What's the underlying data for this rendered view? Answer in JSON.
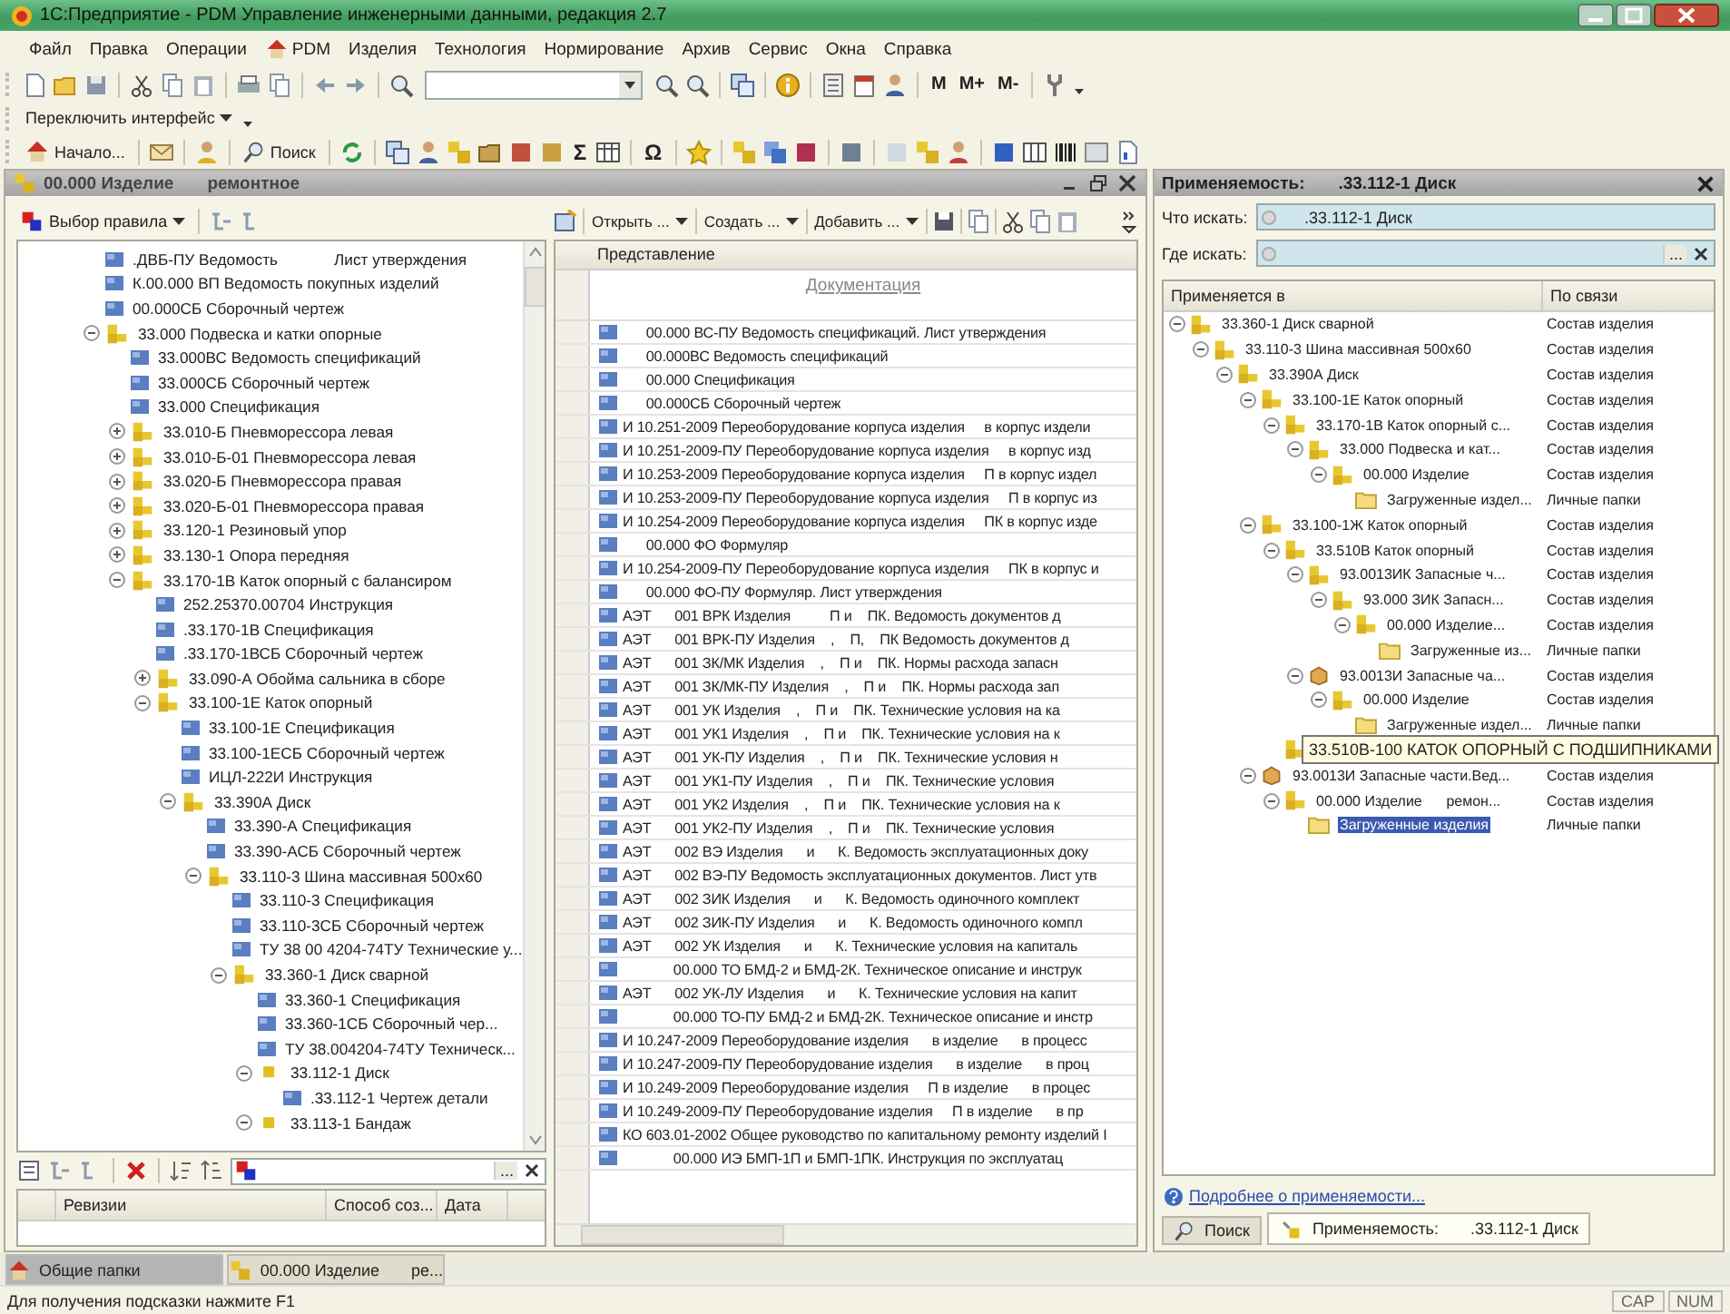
{
  "window": {
    "title": "1С:Предприятие - PDM Управление инженерными данными, редакция 2.7"
  },
  "menu": [
    {
      "label": "Файл",
      "kind": "plain"
    },
    {
      "label": "Правка",
      "kind": "plain"
    },
    {
      "label": "Операции",
      "kind": "plain"
    },
    {
      "label": "PDM",
      "kind": "with_icon"
    },
    {
      "label": "Изделия",
      "kind": "plain"
    },
    {
      "label": "Технология",
      "kind": "plain"
    },
    {
      "label": "Нормирование",
      "kind": "plain"
    },
    {
      "label": "Архив",
      "kind": "plain"
    },
    {
      "label": "Сервис",
      "kind": "plain"
    },
    {
      "label": "Окна",
      "kind": "plain"
    },
    {
      "label": "Справка",
      "kind": "plain"
    }
  ],
  "memory_buttons": [
    "M",
    "M+",
    "M-"
  ],
  "interface_switch": {
    "label": "Переключить интерфейс"
  },
  "quick_toolbar": {
    "buttons": [
      {
        "label": "Начало...",
        "kind": "home"
      },
      {
        "label": "Поиск",
        "kind": "search"
      }
    ],
    "glyphs": [
      "Σ",
      "Ω"
    ]
  },
  "product_window": {
    "title": "00.000 Изделие       ремонтное",
    "rule_button": "Выбор правила",
    "tree": [
      {
        "label": ".ДВБ-ПУ Ведомость             Лист утверждения",
        "kind": "doc"
      },
      {
        "label": "К.00.000 ВП Ведомость покупных изделий",
        "kind": "doc"
      },
      {
        "label": "00.000СБ Сборочный чертеж",
        "kind": "doc"
      },
      {
        "label": "33.000 Подвеска и катки опорные",
        "kind": "assembly",
        "expanded": true,
        "children": [
          {
            "label": "33.000ВС Ведомость спецификаций",
            "kind": "doc"
          },
          {
            "label": "33.000СБ Сборочный чертеж",
            "kind": "doc"
          },
          {
            "label": "33.000 Спецификация",
            "kind": "doc"
          },
          {
            "label": "33.010-Б Пневморессора левая",
            "kind": "assembly",
            "expanded": false
          },
          {
            "label": "33.010-Б-01 Пневморессора левая",
            "kind": "assembly",
            "expanded": false
          },
          {
            "label": "33.020-Б Пневморессора правая",
            "kind": "assembly",
            "expanded": false
          },
          {
            "label": "33.020-Б-01 Пневморессора правая",
            "kind": "assembly",
            "expanded": false
          },
          {
            "label": "33.120-1 Резиновый упор",
            "kind": "assembly",
            "expanded": false
          },
          {
            "label": "33.130-1 Опора передняя",
            "kind": "assembly",
            "expanded": false
          },
          {
            "label": "33.170-1В Каток опорный с балансиром",
            "kind": "assembly",
            "expanded": true,
            "children": [
              {
                "label": "252.25370.00704 Инструкция",
                "kind": "doc"
              },
              {
                "label": ".33.170-1В Спецификация",
                "kind": "doc"
              },
              {
                "label": ".33.170-1ВСБ Сборочный чертеж",
                "kind": "doc"
              },
              {
                "label": "33.090-А Обойма сальника в сборе",
                "kind": "assembly",
                "expanded": false
              },
              {
                "label": "33.100-1Е Каток опорный",
                "kind": "assembly",
                "expanded": true,
                "children": [
                  {
                    "label": "33.100-1Е Спецификация",
                    "kind": "doc"
                  },
                  {
                    "label": "33.100-1ЕСБ Сборочный чертеж",
                    "kind": "doc"
                  },
                  {
                    "label": "ИЦЛ-222И Инструкция",
                    "kind": "doc"
                  },
                  {
                    "label": "33.390А Диск",
                    "kind": "assembly",
                    "expanded": true,
                    "children": [
                      {
                        "label": "33.390-А Спецификация",
                        "kind": "doc"
                      },
                      {
                        "label": "33.390-АСБ Сборочный чертеж",
                        "kind": "doc"
                      },
                      {
                        "label": "33.110-3 Шина массивная 500х60",
                        "kind": "assembly",
                        "expanded": true,
                        "children": [
                          {
                            "label": "33.110-3 Спецификация",
                            "kind": "doc"
                          },
                          {
                            "label": "33.110-3СБ Сборочный чертеж",
                            "kind": "doc"
                          },
                          {
                            "label": "ТУ 38 00 4204-74ТУ Технические у...",
                            "kind": "doc"
                          },
                          {
                            "label": "33.360-1 Диск сварной",
                            "kind": "assembly",
                            "expanded": true,
                            "children": [
                              {
                                "label": "33.360-1 Спецификация",
                                "kind": "doc"
                              },
                              {
                                "label": "33.360-1СБ Сборочный чер...",
                                "kind": "doc"
                              },
                              {
                                "label": "ТУ 38.004204-74ТУ Техническ...",
                                "kind": "doc"
                              },
                              {
                                "label": "33.112-1 Диск",
                                "kind": "part",
                                "expanded": true,
                                "children": [
                                  {
                                    "label": ".33.112-1 Чертеж детали",
                                    "kind": "doc"
                                  }
                                ]
                              },
                              {
                                "label": "33.113-1 Бандаж",
                                "kind": "part",
                                "expanded": true
                              }
                            ]
                          }
                        ]
                      }
                    ]
                  }
                ]
              }
            ]
          }
        ]
      }
    ],
    "filter_field": {
      "select_button": "..."
    },
    "revisions_columns": [
      "Ревизии",
      "Способ соз...",
      "Дата"
    ]
  },
  "documents": {
    "toolbar": [
      "Открыть ...",
      "Создать ...",
      "Добавить ..."
    ],
    "column": "Представление",
    "group": "Документация",
    "rows": [
      {
        "text": "      00.000 ВС-ПУ Ведомость спецификаций. Лист утверждения"
      },
      {
        "text": "      00.000ВС Ведомость спецификаций"
      },
      {
        "text": "      00.000 Спецификация"
      },
      {
        "text": "      00.000СБ Сборочный чертеж"
      },
      {
        "text": "И 10.251-2009 Переоборудование корпуса изделия     в корпус издели"
      },
      {
        "text": "И 10.251-2009-ПУ Переоборудование корпуса изделия     в корпус изд"
      },
      {
        "text": "И 10.253-2009 Переоборудование корпуса изделия     П в корпус издел"
      },
      {
        "text": "И 10.253-2009-ПУ Переоборудование корпуса изделия     П в корпус из"
      },
      {
        "text": "И 10.254-2009 Переоборудование корпуса изделия     ПК в корпус изде"
      },
      {
        "text": "      00.000 ФО Формуляр"
      },
      {
        "text": "И 10.254-2009-ПУ Переоборудование корпуса изделия     ПК в корпус и"
      },
      {
        "text": "      00.000 ФО-ПУ Формуляр. Лист утверждения"
      },
      {
        "text": "АЭТ      001 ВРК Изделия          П и    ПК. Ведомость документов д"
      },
      {
        "text": "АЭТ      001 ВРК-ПУ Изделия    ,    П,    ПК Ведомость документов д"
      },
      {
        "text": "АЭТ      001 ЗК/МК Изделия    ,    П и    ПК. Нормы расхода запасн"
      },
      {
        "text": "АЭТ      001 ЗК/МК-ПУ Изделия    ,    П и    ПК. Нормы расхода зап"
      },
      {
        "text": "АЭТ      001 УК Изделия    ,    П и    ПК. Технические условия на ка"
      },
      {
        "text": "АЭТ      001 УК1 Изделия    ,    П и    ПК. Технические условия на к"
      },
      {
        "text": "АЭТ      001 УК-ПУ Изделия    ,    П и    ПК. Технические условия н"
      },
      {
        "text": "АЭТ      001 УК1-ПУ Изделия    ,    П и    ПК. Технические условия"
      },
      {
        "text": "АЭТ      001 УК2 Изделия    ,    П и    ПК. Технические условия на к"
      },
      {
        "text": "АЭТ      001 УК2-ПУ Изделия    ,    П и    ПК. Технические условия"
      },
      {
        "text": "АЭТ      002 ВЭ Изделия      и      К. Ведомость эксплуатационных доку"
      },
      {
        "text": "АЭТ      002 ВЭ-ПУ Ведомость эксплуатационных документов. Лист утв"
      },
      {
        "text": "АЭТ      002 ЗИК Изделия      и      К. Ведомость одиночного комплект"
      },
      {
        "text": "АЭТ      002 ЗИК-ПУ Изделия      и      К. Ведомость одиночного компл"
      },
      {
        "text": "АЭТ      002 УК Изделия      и      К. Технические условия на капиталь"
      },
      {
        "text": "             00.000 ТО БМД-2 и БМД-2К. Техническое описание и инструк"
      },
      {
        "text": "АЭТ      002 УК-ЛУ Изделия      и      К. Технические условия на капит"
      },
      {
        "text": "             00.000 ТО-ПУ БМД-2 и БМД-2К. Техническое описание и инстр"
      },
      {
        "text": "И 10.247-2009 Переоборудование изделия      в изделие      в процесс"
      },
      {
        "text": "И 10.247-2009-ПУ Переоборудование изделия      в изделие      в проц"
      },
      {
        "text": "И 10.249-2009 Переоборудование изделия     П в изделие      в процес"
      },
      {
        "text": "И 10.249-2009-ПУ Переоборудование изделия     П в изделие      в пр"
      },
      {
        "text": "КО 603.01-2002 Общее руководство по капитальному ремонту изделий I"
      },
      {
        "text": "             00.000 ИЭ БМП-1П и БМП-1ПК. Инструкция по эксплуатац"
      }
    ]
  },
  "usage_panel": {
    "title": "Применяемость:       .33.112-1 Диск",
    "what_label": "Что искать:",
    "what_value": "     .33.112-1 Диск",
    "where_label": "Где искать:",
    "where_select_button": "...",
    "columns": [
      "Применяется в",
      "По связи"
    ],
    "tree": [
      {
        "label": "33.360-1 Диск сварной",
        "relation": "Состав изделия",
        "kind": "assembly",
        "expanded": true,
        "selected": false,
        "children": [
          {
            "label": "33.110-3 Шина массивная 500х60",
            "relation": "Состав изделия",
            "kind": "assembly",
            "expanded": true,
            "selected": false,
            "children": [
              {
                "label": "33.390А Диск",
                "relation": "Состав изделия",
                "kind": "assembly",
                "expanded": true,
                "selected": false,
                "children": [
                  {
                    "label": "33.100-1Е Каток опорный",
                    "relation": "Состав изделия",
                    "kind": "assembly",
                    "expanded": true,
                    "selected": false,
                    "children": [
                      {
                        "label": "33.170-1В Каток опорный с...",
                        "relation": "Состав изделия",
                        "kind": "assembly",
                        "expanded": true,
                        "selected": false,
                        "children": [
                          {
                            "label": "33.000 Подвеска и кат...",
                            "relation": "Состав изделия",
                            "kind": "assembly",
                            "expanded": true,
                            "selected": false,
                            "children": [
                              {
                                "label": "00.000 Изделие",
                                "relation": "Состав изделия",
                                "kind": "assembly",
                                "expanded": true,
                                "selected": false,
                                "children": [
                                  {
                                    "label": "Загруженные издел...",
                                    "relation": "Личные папки",
                                    "kind": "folder",
                                    "selected": false
                                  }
                                ]
                              }
                            ]
                          }
                        ]
                      }
                    ]
                  },
                  {
                    "label": "33.100-1Ж Каток опорный",
                    "relation": "Состав изделия",
                    "kind": "assembly",
                    "expanded": true,
                    "selected": false,
                    "children": [
                      {
                        "label": "33.510В Каток опорный",
                        "relation": "Состав изделия",
                        "kind": "assembly",
                        "expanded": true,
                        "selected": false,
                        "children": [
                          {
                            "label": "93.0013ИК Запасные ч...",
                            "relation": "Состав изделия",
                            "kind": "assembly",
                            "expanded": true,
                            "selected": false,
                            "children": [
                              {
                                "label": "93.000 ЗИК Запасн...",
                                "relation": "Состав изделия",
                                "kind": "assembly",
                                "expanded": true,
                                "selected": false,
                                "children": [
                                  {
                                    "label": "00.000 Изделие...",
                                    "relation": "Состав изделия",
                                    "kind": "assembly",
                                    "expanded": true,
                                    "selected": false,
                                    "children": [
                                      {
                                        "label": "Загруженные из...",
                                        "relation": "Личные папки",
                                        "kind": "folder",
                                        "selected": false
                                      }
                                    ]
                                  }
                                ]
                              }
                            ]
                          },
                          {
                            "label": "93.0013И Запасные ча...",
                            "relation": "Состав изделия",
                            "kind": "kit",
                            "expanded": true,
                            "selected": false,
                            "children": [
                              {
                                "label": "00.000 Изделие",
                                "relation": "Состав изделия",
                                "kind": "assembly",
                                "expanded": true,
                                "selected": false,
                                "children": [
                                  {
                                    "label": "Загруженные издел...",
                                    "relation": "Личные папки",
                                    "kind": "folder",
                                    "selected": false
                                  }
                                ]
                              }
                            ]
                          }
                        ]
                      },
                      {
                        "tooltip": "33.510В-100 КАТОК ОПОРНЫЙ С ПОДШИПНИКАМИ",
                        "kind": "assembly"
                      }
                    ]
                  },
                  {
                    "label": "93.0013И Запасные части.Вед...",
                    "relation": "Состав изделия",
                    "kind": "kit",
                    "expanded": true,
                    "selected": false,
                    "children": [
                      {
                        "label": "00.000 Изделие      ремон...",
                        "relation": "Состав изделия",
                        "kind": "assembly",
                        "expanded": true,
                        "selected": false,
                        "children": [
                          {
                            "label": "Загруженные изделия",
                            "relation": "Личные папки",
                            "kind": "folder",
                            "selected": true
                          }
                        ]
                      }
                    ]
                  }
                ]
              }
            ]
          }
        ]
      }
    ],
    "help_link": "Подробнее о применяемости...",
    "tabs": [
      {
        "label": "Поиск",
        "kind": "search",
        "selected": false
      },
      {
        "label": "Применяемость:       .33.112-1 Диск",
        "kind": "usage",
        "selected": true
      }
    ]
  },
  "taskbar": [
    {
      "label": "Общие папки",
      "kind": "folders",
      "selected": true
    },
    {
      "label": "00.000 Изделие       ре...",
      "kind": "product",
      "selected": false
    }
  ],
  "status_bar": {
    "hint": "Для получения подсказки нажмите F1",
    "indicators": [
      "CAP",
      "NUM"
    ]
  }
}
